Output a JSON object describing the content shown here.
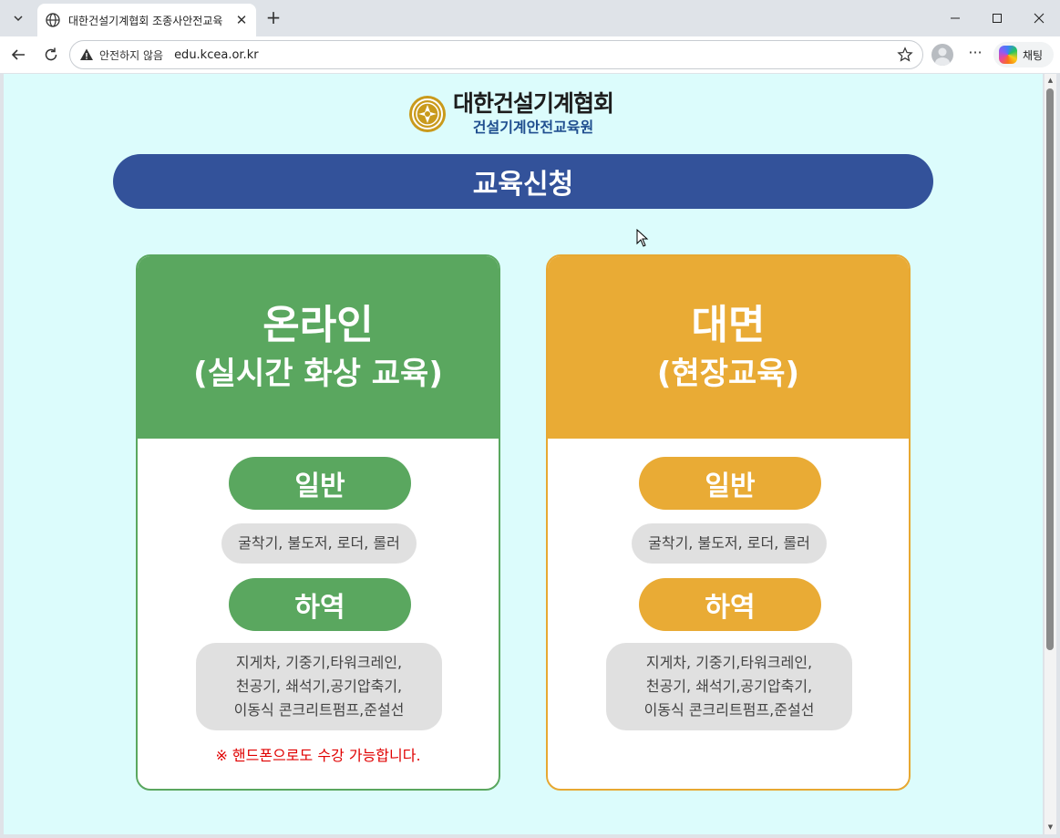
{
  "browser": {
    "tab_title": "대한건설기계협회 조종사안전교육",
    "insecure_label": "안전하지 않음",
    "url": "edu.kcea.or.kr",
    "chat_label": "채팅"
  },
  "page": {
    "logo_main": "대한건설기계협회",
    "logo_sub": "건설기계안전교육원",
    "banner_title": "교육신청",
    "online": {
      "title": "온라인",
      "subtitle": "(실시간 화상 교육)",
      "general_label": "일반",
      "general_items": "굴착기, 불도저, 로더, 롤러",
      "lower_label": "하역",
      "lower_items": [
        "지게차, 기중기,타워크레인,",
        "천공기, 쇄석기,공기압축기,",
        "이동식 콘크리트펌프,준설선"
      ],
      "note": "※ 핸드폰으로도 수강 가능합니다."
    },
    "offline": {
      "title": "대면",
      "subtitle": "(현장교육)",
      "general_label": "일반",
      "general_items": "굴착기, 불도저, 로더, 롤러",
      "lower_label": "하역",
      "lower_items": [
        "지게차, 기중기,타워크레인,",
        "천공기, 쇄석기,공기압축기,",
        "이동식 콘크리트펌프,준설선"
      ]
    }
  },
  "colors": {
    "banner": "#33529a",
    "online": "#5aa75f",
    "offline": "#e9ab35",
    "background": "#dcfcfc",
    "note": "#e00000"
  }
}
